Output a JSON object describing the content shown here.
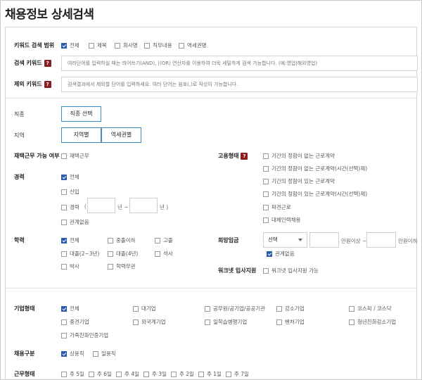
{
  "page": {
    "title": "채용정보 상세검색"
  },
  "keyword_scope": {
    "label": "키워드 검색 범위",
    "options": [
      {
        "label": "전체",
        "checked": true
      },
      {
        "label": "제목",
        "checked": false
      },
      {
        "label": "회사명",
        "checked": false
      },
      {
        "label": "직무내용",
        "checked": false
      },
      {
        "label": "역세권명",
        "checked": false
      }
    ]
  },
  "search_keyword": {
    "label": "검색 키워드",
    "help": "?",
    "placeholder": "여러단어를 입력하실 때는 띄어쓰기(AND), |(OR) 연산자를 이용하여 더욱 세밀하게 검색 가능합니다. (예:영업|해외영업)"
  },
  "exclude_keyword": {
    "label": "제외 키워드",
    "help": "?",
    "placeholder": "검색결과에서 제외할 단어를 입력하세요. 여러 단어는 쉼표(,)로 작성이 가능합니다."
  },
  "job_type": {
    "label": "직종",
    "button": "직종 선택"
  },
  "region": {
    "label": "지역",
    "buttons": [
      "지역별",
      "역세권별"
    ]
  },
  "remote": {
    "label": "재택근무 가능 여부",
    "option": {
      "label": "재택근무",
      "checked": false
    }
  },
  "employment_type": {
    "label": "고용형태",
    "help": "?",
    "options": [
      {
        "label": "기간의 정함이 없는 근로계약",
        "checked": false
      },
      {
        "label": "기간의 정함이 없는 근로계약(시간(선택)제)",
        "checked": false
      },
      {
        "label": "기간의 정함이 있는 근로계약",
        "checked": false
      },
      {
        "label": "기간의 정함이 있는 근로계약(시간(선택)제)",
        "checked": false
      },
      {
        "label": "파견근로",
        "checked": false
      },
      {
        "label": "대체인력채용",
        "checked": false
      }
    ]
  },
  "career": {
    "label": "경력",
    "options": [
      {
        "label": "전체",
        "checked": true
      },
      {
        "label": "신입",
        "checked": false
      },
      {
        "label": "경력",
        "checked": false
      },
      {
        "label": "관계없음",
        "checked": false
      }
    ],
    "paren_open": "(",
    "year_sep": "년 ~",
    "year_end": "년 )"
  },
  "education": {
    "label": "학력",
    "options": [
      {
        "label": "전체",
        "checked": true
      },
      {
        "label": "중졸이하",
        "checked": false
      },
      {
        "label": "고졸",
        "checked": false
      },
      {
        "label": "대졸(2~3년)",
        "checked": false
      },
      {
        "label": "대졸(4년)",
        "checked": false
      },
      {
        "label": "석사",
        "checked": false
      },
      {
        "label": "박사",
        "checked": false
      },
      {
        "label": "학력무관",
        "checked": false
      }
    ]
  },
  "desired_wage": {
    "label": "희망임금",
    "select_value": "선택",
    "unit_min": "만원이상 ~",
    "unit_max": "만원이하",
    "any": {
      "label": "관계없음",
      "checked": true
    }
  },
  "worknet_support": {
    "label": "워크넷 입사지원",
    "option": {
      "label": "워크넷 입사지원 가능",
      "checked": false
    }
  },
  "company_type": {
    "label": "기업형태",
    "options": [
      {
        "label": "전체",
        "checked": true
      },
      {
        "label": "대기업",
        "checked": false
      },
      {
        "label": "공무원/공기업/공공기관",
        "checked": false
      },
      {
        "label": "강소기업",
        "checked": false
      },
      {
        "label": "코스피 / 코스닥",
        "checked": false
      },
      {
        "label": "중견기업",
        "checked": false
      },
      {
        "label": "외국계기업",
        "checked": false
      },
      {
        "label": "일학습병행기업",
        "checked": false
      },
      {
        "label": "벤처기업",
        "checked": false
      },
      {
        "label": "청년친화강소기업",
        "checked": false
      },
      {
        "label": "가족친화인증기업",
        "checked": false
      }
    ]
  },
  "hire_category": {
    "label": "채용구분",
    "options": [
      {
        "label": "상용직",
        "checked": true
      },
      {
        "label": "일용직",
        "checked": false
      }
    ]
  },
  "work_schedule": {
    "label": "근무형태",
    "options": [
      {
        "label": "주 5일",
        "checked": false
      },
      {
        "label": "주 6일",
        "checked": false
      },
      {
        "label": "주 4일",
        "checked": false
      },
      {
        "label": "주 3일",
        "checked": false
      },
      {
        "label": "주 2일",
        "checked": false
      },
      {
        "label": "주 1일",
        "checked": false
      },
      {
        "label": "주 7일",
        "checked": false
      }
    ]
  }
}
